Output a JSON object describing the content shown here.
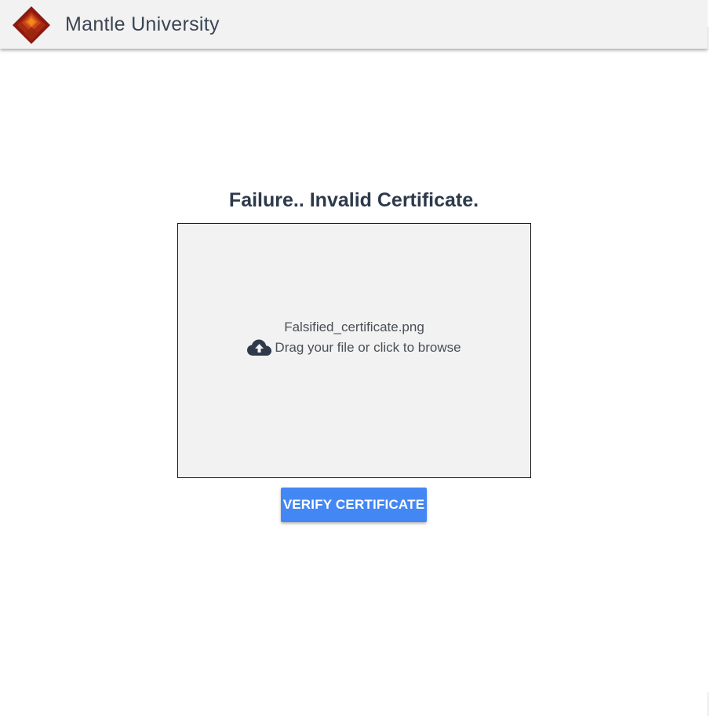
{
  "header": {
    "brand_name": "Mantle University",
    "logo_icon": "diamond-logo-icon",
    "background": "#f2f2f2"
  },
  "main": {
    "status_message": "Failure.. Invalid Certificate.",
    "dropzone": {
      "file_name": "Falsified_certificate.png",
      "hint": "Drag your file or click to browse",
      "icon": "cloud-upload-icon"
    },
    "verify_button_label": "VERIFY CERTIFICATE"
  },
  "colors": {
    "accent": "#4387f5",
    "title_text": "#2e3a4a",
    "logo_dark": "#8b1a10",
    "logo_mid": "#c8421b",
    "logo_light": "#f08a1c"
  }
}
